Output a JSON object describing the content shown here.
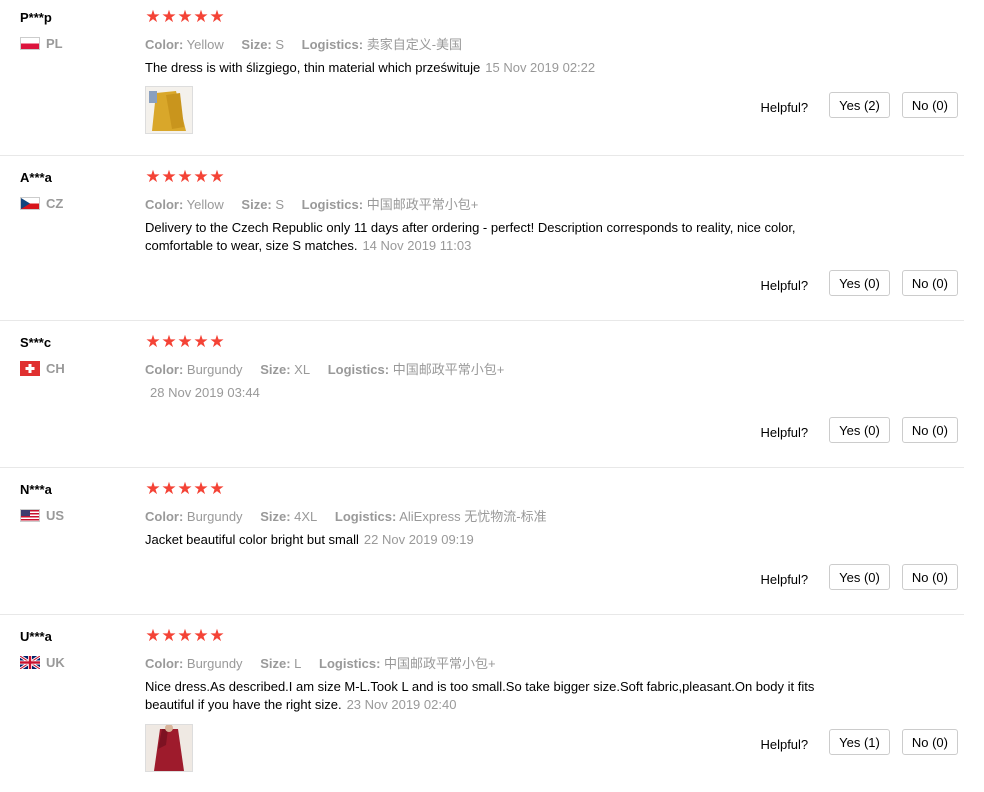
{
  "labels": {
    "color": "Color:",
    "size": "Size:",
    "logistics": "Logistics:",
    "helpful": "Helpful?"
  },
  "star_char": "★",
  "rating_color": "#f44336",
  "reviews": [
    {
      "user": "P***p",
      "country": "PL",
      "stars": 5,
      "color": "Yellow",
      "size": "S",
      "logistics": "卖家自定义-美国",
      "text": "The dress is with ślizgiego, thin material which prześwituje",
      "date": "15 Nov 2019 02:22",
      "yes": "Yes (2)",
      "no": "No (0)"
    },
    {
      "user": "A***a",
      "country": "CZ",
      "stars": 5,
      "color": "Yellow",
      "size": "S",
      "logistics": "中国邮政平常小包+",
      "text": "Delivery to the Czech Republic only 11 days after ordering - perfect! Description corresponds to reality, nice color, comfortable to wear, size S matches.",
      "date": "14 Nov 2019 11:03",
      "yes": "Yes (0)",
      "no": "No (0)"
    },
    {
      "user": "S***c",
      "country": "CH",
      "stars": 5,
      "color": "Burgundy",
      "size": "XL",
      "logistics": "中国邮政平常小包+",
      "text": "",
      "date": "28 Nov 2019 03:44",
      "yes": "Yes (0)",
      "no": "No (0)"
    },
    {
      "user": "N***a",
      "country": "US",
      "stars": 5,
      "color": "Burgundy",
      "size": "4XL",
      "logistics": "AliExpress 无忧物流-标准",
      "text": "Jacket beautiful color bright but small",
      "date": "22 Nov 2019 09:19",
      "yes": "Yes (0)",
      "no": "No (0)"
    },
    {
      "user": "U***a",
      "country": "UK",
      "stars": 5,
      "color": "Burgundy",
      "size": "L",
      "logistics": "中国邮政平常小包+",
      "text": "Nice dress.As described.I am size M-L.Took L and is too small.So take bigger size.Soft fabric,pleasant.On body it fits beautiful if you have the right size.",
      "date": "23 Nov 2019 02:40",
      "yes": "Yes (1)",
      "no": "No (0)"
    }
  ]
}
